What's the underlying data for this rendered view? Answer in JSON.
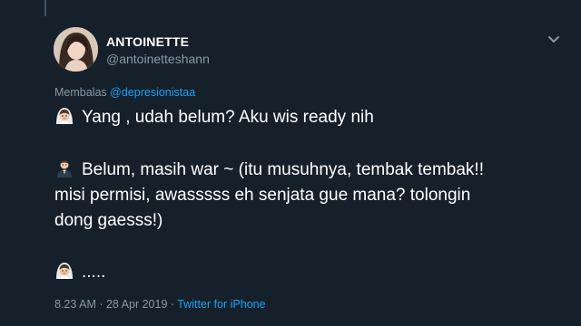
{
  "user": {
    "name": "ANTOINETTE",
    "handle": "@antoinetteshann"
  },
  "reply": {
    "prefix": "Membalas",
    "to": "@depresionistaa"
  },
  "tweet": {
    "line1": "Yang , udah belum? Aku wis ready nih",
    "line2": "Belum, masih war ~ (itu musuhnya, tembak tembak!!",
    "line3": "misi permisi, awasssss eh senjata gue mana? tolongin",
    "line4": "dong gaesss!)",
    "line5": ".....",
    "emoji_bride": "bride-with-veil-icon",
    "emoji_groom": "man-in-tuxedo-icon"
  },
  "meta": {
    "time": "8.23 AM",
    "separator1": " · ",
    "date": "28 Apr 2019",
    "separator2": " · ",
    "source": "Twitter for iPhone"
  },
  "colors": {
    "background": "#15202b",
    "text": "#ffffff",
    "muted": "#8899a6",
    "link": "#1da1f2"
  }
}
